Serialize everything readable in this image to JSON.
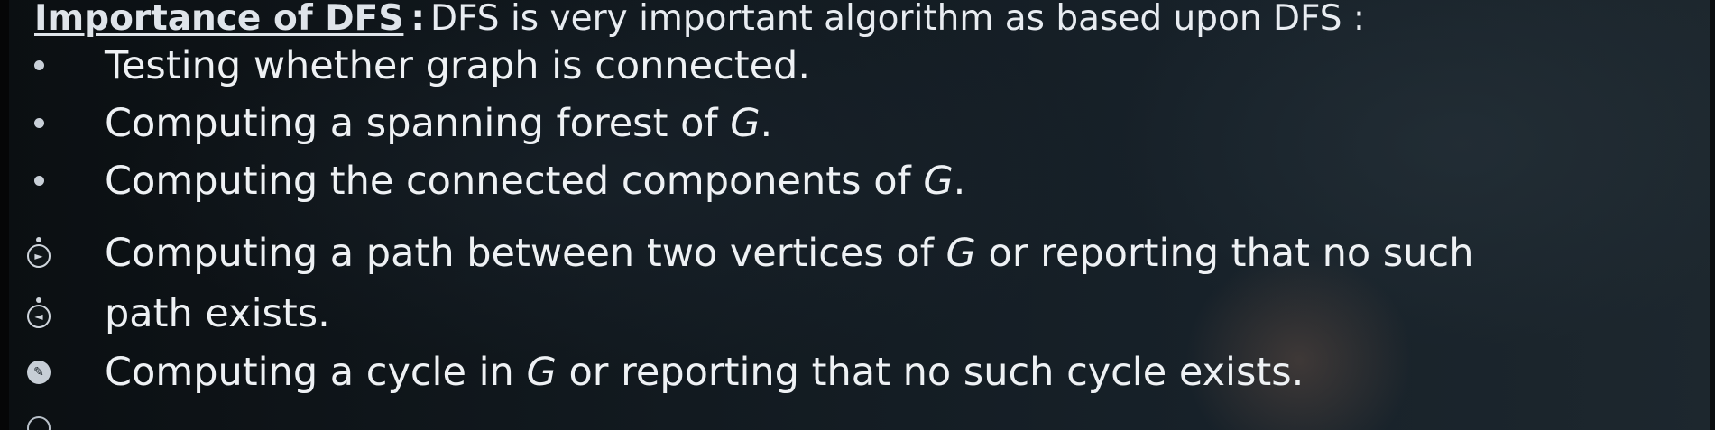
{
  "slide": {
    "heading": {
      "term": "Importance of DFS",
      "separator": ":",
      "description": "DFS is very important algorithm as based upon DFS :"
    },
    "bullets": [
      "Testing whether graph is connected.",
      "Computing a spanning forest of G.",
      "Computing the connected components of G.",
      "Computing a path between two vertices of G or reporting that no such",
      "path exists.",
      "Computing a cycle in G or reporting that no such cycle exists."
    ]
  },
  "overlay_icons": [
    "play-circle-icon",
    "rewind-circle-icon",
    "pencil-circle-icon",
    "circle-icon"
  ],
  "colors": {
    "background": "#121a20",
    "text": "#eef1f4",
    "bullet": "#c9d0d8"
  }
}
